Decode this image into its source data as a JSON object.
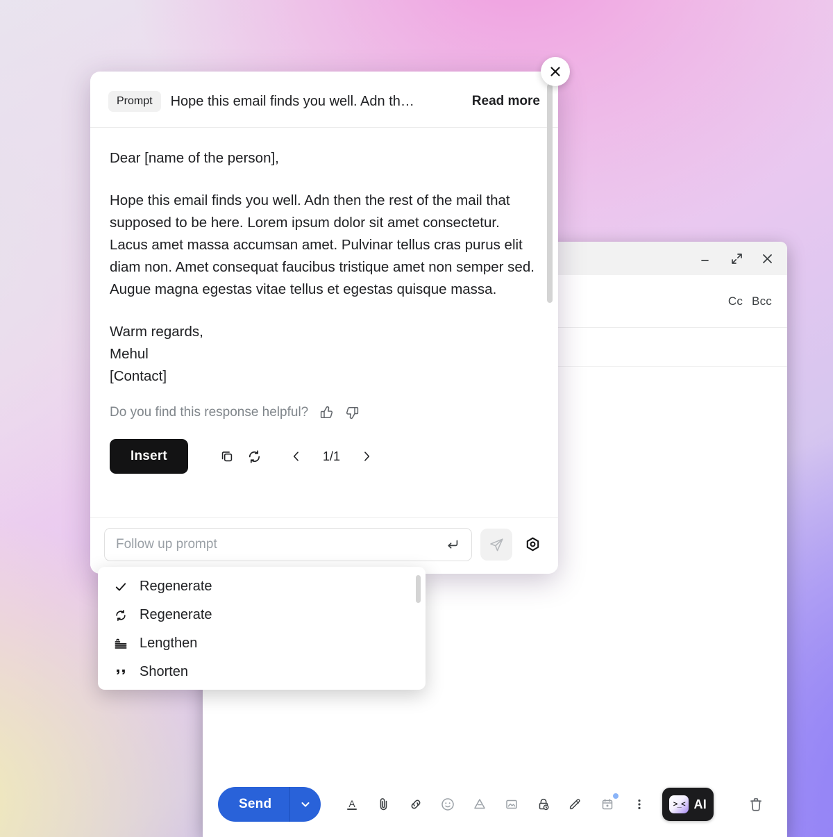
{
  "compose_window": {
    "window_controls": [
      {
        "name": "minimize",
        "glyph": "minimize-icon"
      },
      {
        "name": "expand",
        "glyph": "expand-icon"
      },
      {
        "name": "close",
        "glyph": "close-icon"
      }
    ],
    "cc_label": "Cc",
    "bcc_label": "Bcc",
    "toolbar": {
      "send_label": "Send",
      "send_color": "#2962d9",
      "ai_label": "AI",
      "ai_face": ">_<",
      "icons": [
        "formatting-options-icon",
        "attach-file-icon",
        "insert-link-icon",
        "insert-emoji-icon",
        "insert-drive-icon",
        "insert-photo-icon",
        "confidential-mode-icon",
        "signature-icon",
        "schedule-send-icon",
        "more-options-icon"
      ],
      "discard_icon": "trash-icon"
    }
  },
  "ai_panel": {
    "prompt_badge": "Prompt",
    "prompt_preview": "Hope this email finds you well. Adn th…",
    "read_more": "Read more",
    "response": {
      "greeting": "Dear [name of the person],",
      "body": "Hope this email finds you well. Adn then the rest of the mail that supposed to be here. Lorem ipsum dolor sit amet consectetur. Lacus amet massa accumsan amet. Pulvinar tellus cras purus elit diam non. Amet consequat faucibus tristique amet non semper sed. Augue magna egestas vitae tellus et egestas quisque massa.",
      "closing": "Warm regards,",
      "signer": "Mehul",
      "contact": "[Contact]"
    },
    "feedback_label": "Do you find this response helpful?",
    "feedback_icons": [
      "thumbs-up-icon",
      "thumbs-down-icon"
    ],
    "actions": {
      "insert_label": "Insert",
      "copy_icon": "copy-icon",
      "regenerate_icon": "regenerate-icon",
      "prev_icon": "chevron-left-icon",
      "next_icon": "chevron-right-icon",
      "page_counter": "1/1"
    },
    "followup": {
      "placeholder": "Follow up prompt",
      "value": "",
      "enter_icon": "enter-return-icon",
      "send_icon": "send-plane-icon",
      "settings_icon": "settings-hex-icon"
    },
    "close_icon": "close-icon"
  },
  "dropdown": {
    "items": [
      {
        "label": "Regenerate",
        "icon": "check-icon",
        "selected": true
      },
      {
        "label": "Regenerate",
        "icon": "refresh-icon",
        "selected": false
      },
      {
        "label": "Lengthen",
        "icon": "lengthen-icon",
        "selected": false
      },
      {
        "label": "Shorten",
        "icon": "shorten-quote-icon",
        "selected": false
      }
    ]
  },
  "colors": {
    "accent_blue": "#2962d9",
    "dark_button": "#131314",
    "muted_text": "#80868b"
  }
}
